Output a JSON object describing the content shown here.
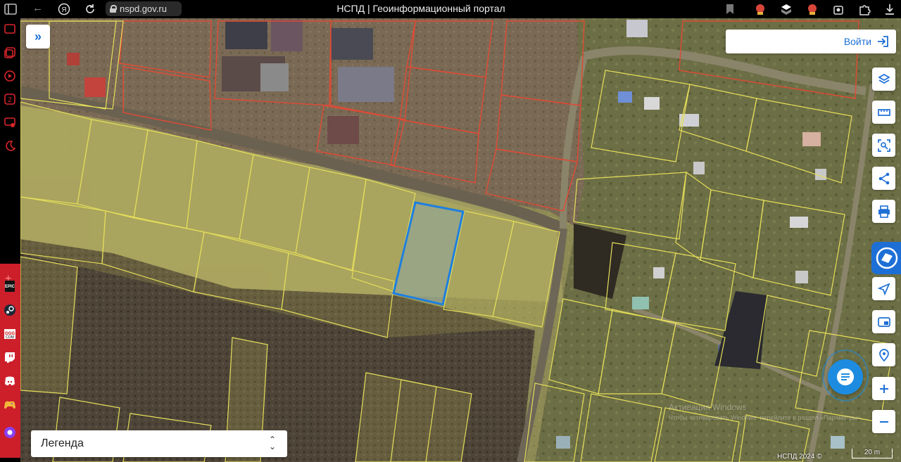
{
  "browser": {
    "url": "nspd.gov.ru",
    "title": "НСПД | Геоинформационный портал"
  },
  "map": {
    "login_label": "Войти",
    "legend_label": "Легенда",
    "copyright": "НСПД 2024 ©",
    "scale_label": "20 m",
    "watermark_line1": "Активация Windows",
    "watermark_line2": "Чтобы активировать Windows, перейдите в раздел «Параметры»."
  },
  "icons": {
    "sidebar": [
      "collapse-icon",
      "layers-icon",
      "ruler-icon",
      "select-area-icon",
      "share-icon",
      "print-icon",
      "geolocation-icon",
      "picture-in-picture-icon",
      "find-location-icon",
      "zoom-in-icon",
      "zoom-out-icon",
      "chat-icon"
    ]
  },
  "colors": {
    "accent": "#1d6fd6",
    "parcel_outline": "#e6df5a",
    "selected_parcel": "#1e7fe0",
    "red_parcel": "#e04a35"
  }
}
